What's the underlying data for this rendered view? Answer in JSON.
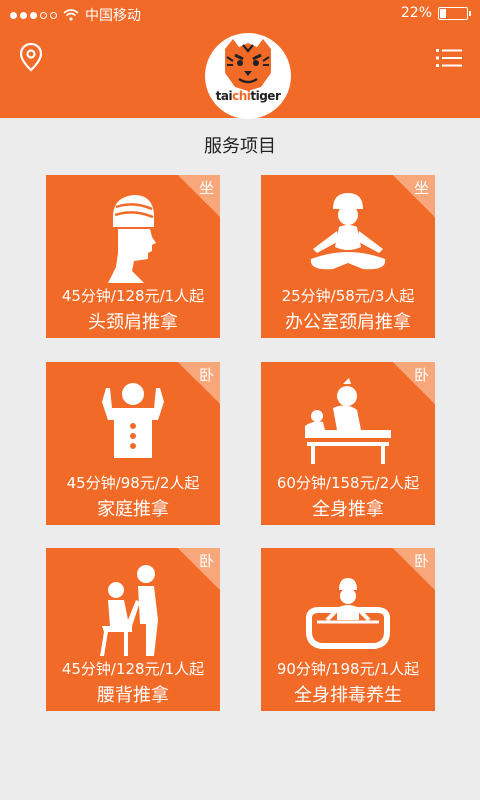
{
  "status": {
    "carrier": "中国移动",
    "battery": "22%",
    "battery_level": 0.22
  },
  "header": {
    "logo_text_part1": "tai",
    "logo_text_part2": "chi",
    "logo_text_part3": "tiger"
  },
  "section": {
    "title": "服务项目"
  },
  "services": [
    {
      "info": "45分钟/128元/1人起",
      "name": "头颈肩推拿",
      "tag": "坐"
    },
    {
      "info": "25分钟/58元/3人起",
      "name": "办公室颈肩推拿",
      "tag": "坐"
    },
    {
      "info": "45分钟/98元/2人起",
      "name": "家庭推拿",
      "tag": "卧"
    },
    {
      "info": "60分钟/158元/2人起",
      "name": "全身推拿",
      "tag": "卧"
    },
    {
      "info": "45分钟/128元/1人起",
      "name": "腰背推拿",
      "tag": "卧"
    },
    {
      "info": "90分钟/198元/1人起",
      "name": "全身排毒养生",
      "tag": "卧"
    }
  ],
  "colors": {
    "brand": "#f26a28",
    "background": "#ececec"
  }
}
